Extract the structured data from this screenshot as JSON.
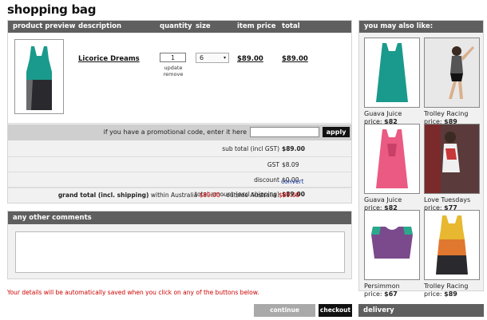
{
  "page": {
    "title": "shopping bag"
  },
  "bag": {
    "headers": {
      "preview": "product preview",
      "description": "description",
      "quantity": "quantity",
      "size": "size",
      "item_price": "item price",
      "total": "total"
    },
    "item": {
      "name": "Licorice Dreams",
      "quantity": "1",
      "update": "update",
      "remove": "remove",
      "size": "6",
      "item_price": "$89.00",
      "total": "$89.00"
    },
    "promo": {
      "label": "if you have a promotional code, enter it here",
      "value": "",
      "apply": "apply"
    },
    "totals": {
      "subtotal_label": "sub total (incl GST)",
      "subtotal": "$89.00",
      "gst_label": "GST",
      "gst": "$8.09",
      "discount_label": "discount",
      "discount": "$0.00",
      "total_label": "total amount (excl shipping)",
      "total": "$89.00",
      "convert": "convert"
    },
    "grand": {
      "label": "grand total (incl. shipping)",
      "within": "within Australia",
      "within_amount": "$89.00",
      "dash": "-",
      "outside": "outside Australia",
      "outside_amount": "$89.00"
    }
  },
  "comments": {
    "title": "any other comments",
    "value": ""
  },
  "notice": "Your details will be automatically saved when you click on any of the buttons below.",
  "buttons": {
    "continue": "continue shopping",
    "checkout": "checkout"
  },
  "sidebar": {
    "title": "you may also like:",
    "items": [
      {
        "name": "Guava Juice",
        "price_label": "price:",
        "price": "$82"
      },
      {
        "name": "Trolley Racing",
        "price_label": "price:",
        "price": "$89"
      },
      {
        "name": "Guava Juice",
        "price_label": "price:",
        "price": "$82"
      },
      {
        "name": "Love Tuesdays",
        "price_label": "price:",
        "price": "$77"
      },
      {
        "name": "Persimmon",
        "price_label": "price:",
        "price": "$67"
      },
      {
        "name": "Trolley Racing",
        "price_label": "price:",
        "price": "$89"
      }
    ],
    "delivery": "delivery"
  },
  "colors": {
    "header_bg": "#5f5f5f",
    "accent_red": "#cc0000",
    "link_blue": "#1a3aa0",
    "teal": "#1a9a8c",
    "pink": "#ea5a82",
    "purple": "#7a4a8c",
    "orange": "#e07830",
    "yellow": "#e8b830"
  }
}
